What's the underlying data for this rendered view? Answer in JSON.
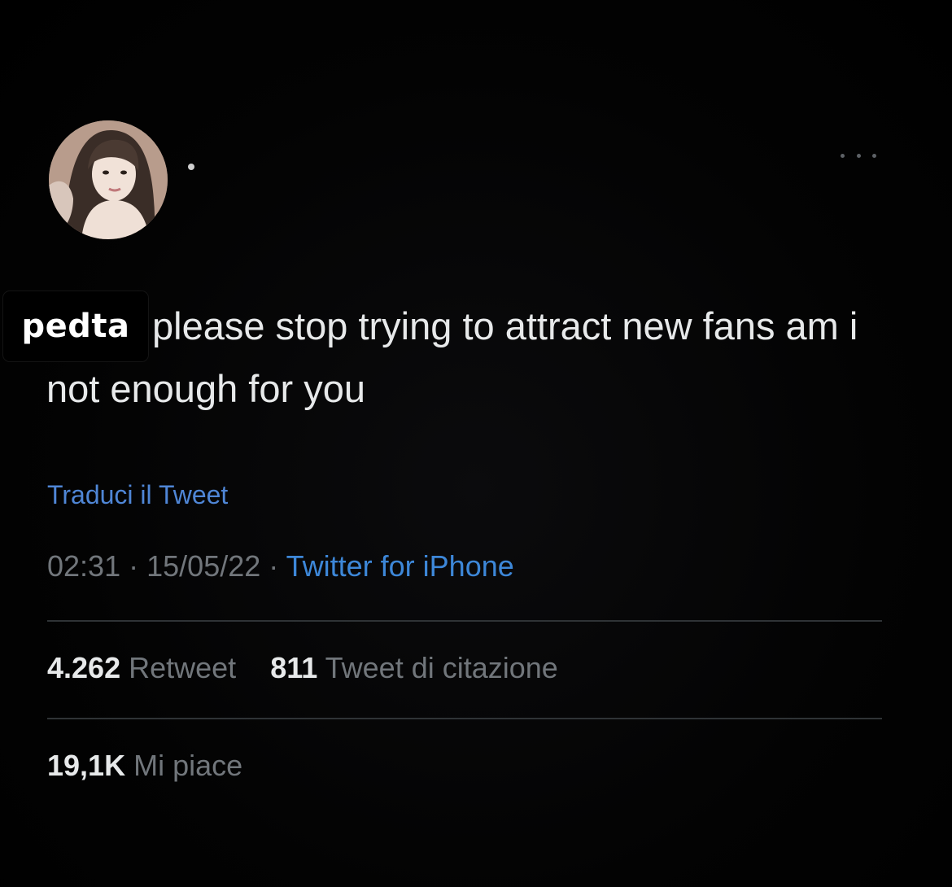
{
  "tweet": {
    "author": {
      "avatar_icon": "profile-photo",
      "overlay_label": "pedta"
    },
    "more_icon": "more-options-icon",
    "text": "please stop trying to attract new fans am i not enough for you",
    "translate_label": "Traduci il Tweet",
    "time": "02:31",
    "separator": "·",
    "date": "15/05/22",
    "source": "Twitter for iPhone",
    "retweets": {
      "count": "4.262",
      "label": "Retweet"
    },
    "quotes": {
      "count": "811",
      "label": "Tweet di citazione"
    },
    "likes": {
      "count": "19,1K",
      "label": "Mi piace"
    }
  },
  "colors": {
    "background": "#000000",
    "text": "#e7e9ea",
    "muted": "#71767b",
    "link": "#3d87d8",
    "divider": "#2f3336"
  }
}
